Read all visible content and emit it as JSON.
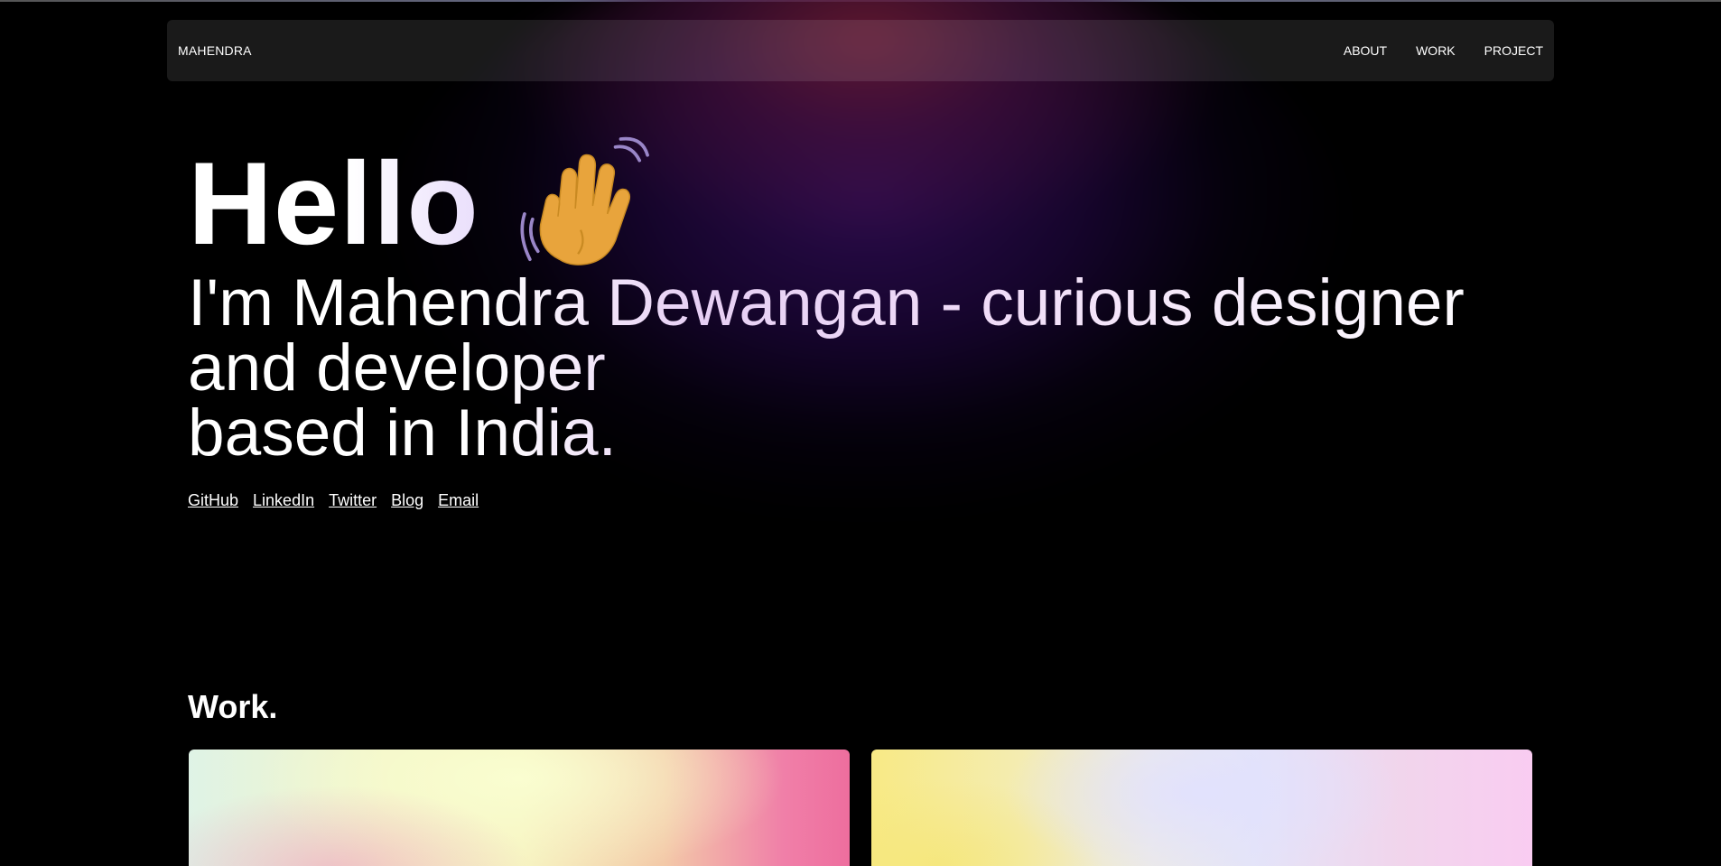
{
  "nav": {
    "brand": "MAHENDRA",
    "links": [
      "ABOUT",
      "WORK",
      "PROJECT"
    ]
  },
  "hero": {
    "greeting": "Hello",
    "wave_icon": "waving-hand-icon",
    "intro_lines": [
      "I'm Mahendra Dewangan - curious designer",
      "and developer",
      "based in India."
    ],
    "social_links": [
      "GitHub",
      "LinkedIn",
      "Twitter",
      "Blog",
      "Email"
    ]
  },
  "work": {
    "title": "Work."
  },
  "colors": {
    "background": "#000000",
    "glow_purple": "#2d0c50",
    "glow_red": "#781e32",
    "wave_skin": "#e8a43c"
  }
}
